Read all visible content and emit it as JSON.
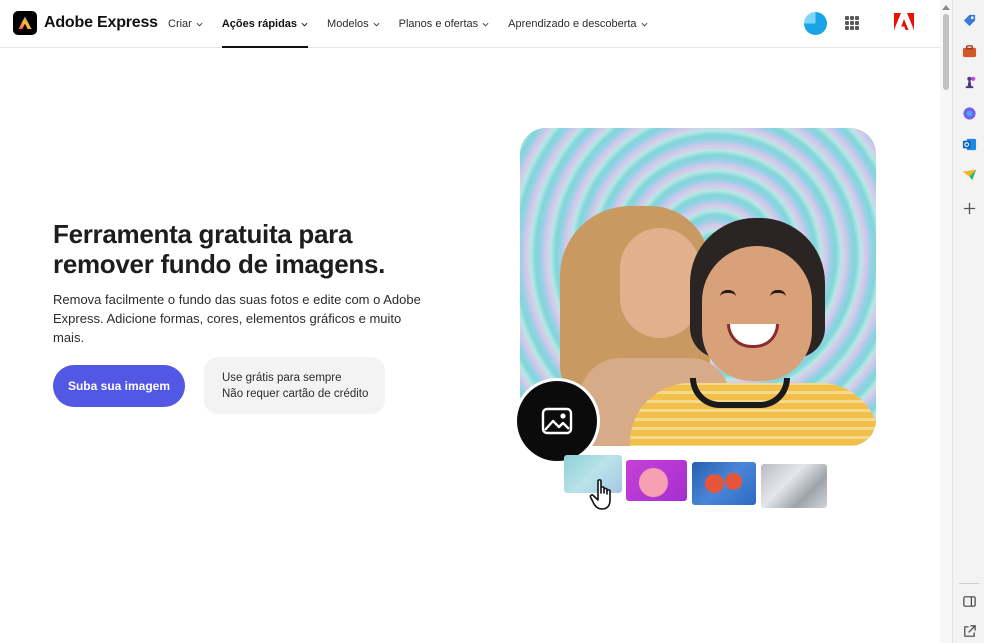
{
  "brand": {
    "name": "Adobe Express"
  },
  "nav": {
    "items": [
      {
        "label": "Criar",
        "active": false
      },
      {
        "label": "Ações rápidas",
        "active": true
      },
      {
        "label": "Modelos",
        "active": false
      },
      {
        "label": "Planos e ofertas",
        "active": false
      },
      {
        "label": "Aprendizado e descoberta",
        "active": false
      }
    ]
  },
  "hero": {
    "title": "Ferramenta gratuita para remover fundo de imagens.",
    "description": "Remova facilmente o fundo das suas fotos e edite com o Adobe Express. Adicione formas, cores, elementos gráficos e muito mais.",
    "cta_label": "Suba sua imagem",
    "info_line1": "Use grátis para sempre",
    "info_line2": "Não requer cartão de crédito"
  },
  "colors": {
    "cta": "#5258e4",
    "adobe_red": "#eb1000",
    "avatar": "#1aa3e6"
  },
  "sidebar_icons": [
    "tag-icon",
    "briefcase-icon",
    "chess-icon",
    "copilot-icon",
    "outlook-icon",
    "send-icon",
    "add-icon",
    "split-view-icon",
    "external-link-icon"
  ]
}
